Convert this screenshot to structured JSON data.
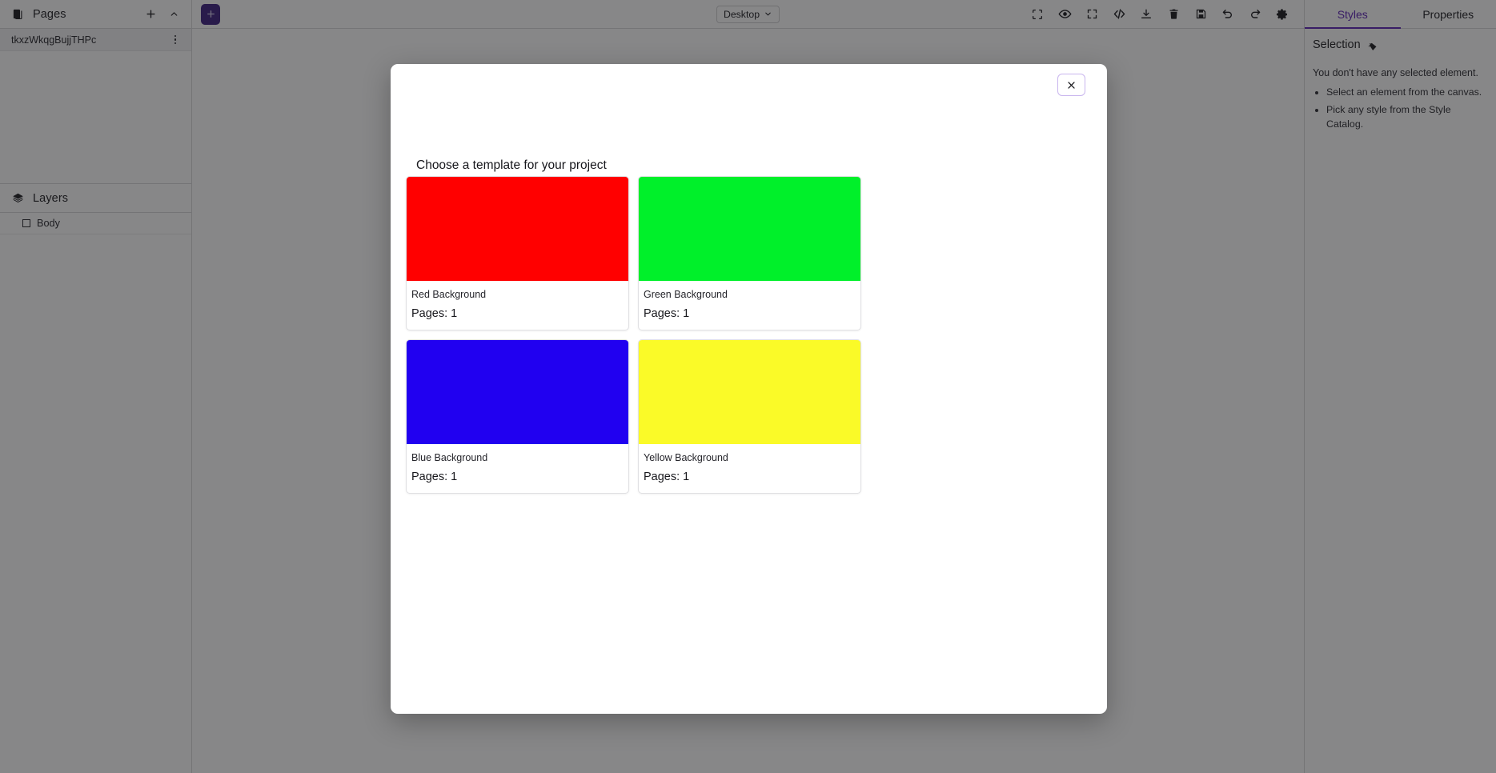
{
  "colors": {
    "accent_purple": "#5b21b6",
    "add_button_bg": "#3b1f80",
    "close_border": "#c9b6ee",
    "overlay": "rgba(24,24,27,0.52)"
  },
  "sidebar": {
    "pages_panel": {
      "title": "Pages",
      "icon": "pages-icon",
      "add_icon": "plus-icon",
      "collapse_icon": "chevron-up-icon",
      "items": [
        {
          "name": "tkxzWkqgBujjTHPc",
          "menu_icon": "kebab-menu-icon"
        }
      ]
    },
    "layers_panel": {
      "title": "Layers",
      "icon": "layers-icon",
      "items": [
        {
          "name": "Body",
          "icon": "square-icon"
        }
      ]
    }
  },
  "toolbar": {
    "add_button": {
      "label": "+",
      "icon": "plus-icon"
    },
    "device_select": {
      "value": "Desktop",
      "caret_icon": "chevron-down-icon"
    },
    "actions": [
      {
        "name": "borders-icon",
        "title": "Toggle borders"
      },
      {
        "name": "eye-icon",
        "title": "Preview"
      },
      {
        "name": "fullscreen-icon",
        "title": "Fullscreen"
      },
      {
        "name": "code-icon",
        "title": "View code"
      },
      {
        "name": "import-icon",
        "title": "Import"
      },
      {
        "name": "trash-icon",
        "title": "Clear canvas"
      },
      {
        "name": "save-icon",
        "title": "Save"
      },
      {
        "name": "undo-icon",
        "title": "Undo"
      },
      {
        "name": "redo-icon",
        "title": "Redo"
      },
      {
        "name": "gear-icon",
        "title": "Settings"
      }
    ]
  },
  "right_panel": {
    "tabs": [
      {
        "label": "Styles",
        "active": true
      },
      {
        "label": "Properties",
        "active": false
      }
    ],
    "selection": {
      "label": "Selection",
      "icon": "brush-icon"
    },
    "empty_message": "You don't have any selected element.",
    "hints": [
      "Select an element from the canvas.",
      "Pick any style from the Style Catalog."
    ]
  },
  "modal": {
    "title": "Choose a template for your project",
    "close_icon": "close-icon",
    "close_label": "×",
    "templates": [
      {
        "name": "Red Background",
        "pages_label": "Pages: 1",
        "color": "#FF0000"
      },
      {
        "name": "Green Background",
        "pages_label": "Pages: 1",
        "color": "#00F02A"
      },
      {
        "name": "Blue Background",
        "pages_label": "Pages: 1",
        "color": "#2100F0"
      },
      {
        "name": "Yellow Background",
        "pages_label": "Pages: 1",
        "color": "#FAFA28"
      }
    ]
  }
}
